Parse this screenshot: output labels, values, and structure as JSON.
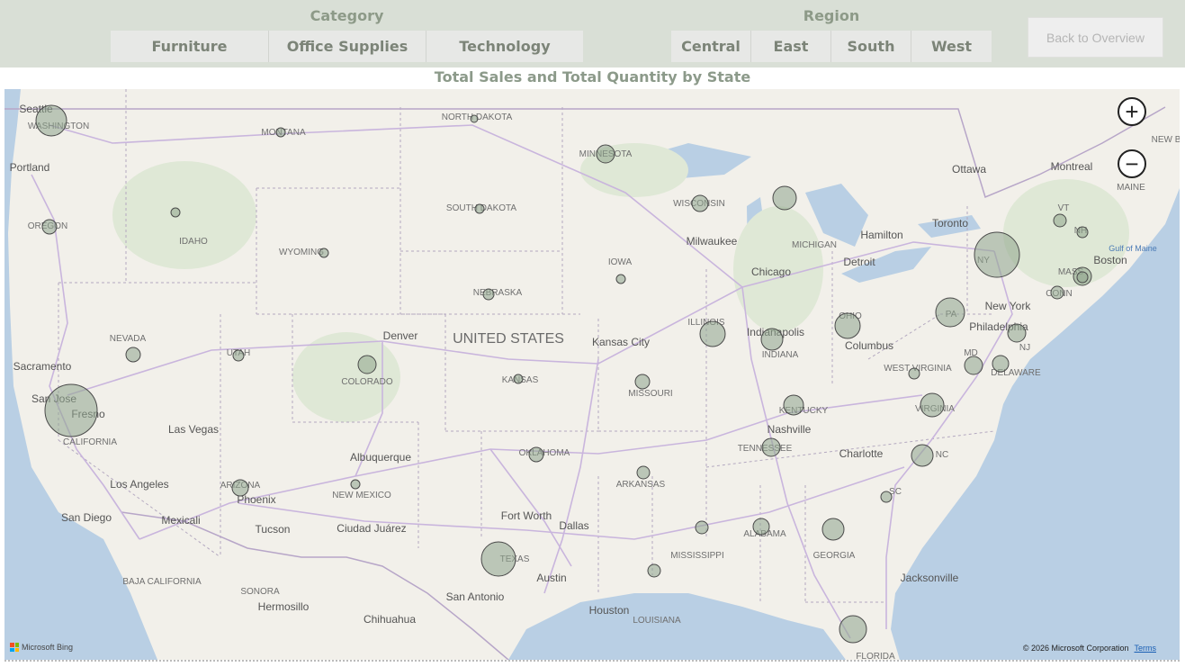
{
  "category_slicer": {
    "title": "Category",
    "options": [
      "Furniture",
      "Office Supplies",
      "Technology"
    ]
  },
  "region_slicer": {
    "title": "Region",
    "options": [
      "Central",
      "East",
      "South",
      "West"
    ]
  },
  "back_button": {
    "label": "Back to Overview"
  },
  "chart": {
    "title": "Total Sales and Total Quantity by State"
  },
  "map": {
    "zoom_in": "+",
    "zoom_out": "−",
    "country_label": "UNITED STATES",
    "state_labels": [
      "WASHINGTON",
      "OREGON",
      "IDAHO",
      "MONTANA",
      "NORTH DAKOTA",
      "SOUTH DAKOTA",
      "WYOMING",
      "NEBRASKA",
      "NEVADA",
      "UTAH",
      "COLORADO",
      "KANSAS",
      "CALIFORNIA",
      "ARIZONA",
      "NEW MEXICO",
      "OKLAHOMA",
      "TEXAS",
      "MINNESOTA",
      "IOWA",
      "MISSOURI",
      "ARKANSAS",
      "WISCONSIN",
      "ILLINOIS",
      "MICHIGAN",
      "INDIANA",
      "OHIO",
      "KENTUCKY",
      "TENNESSEE",
      "MISSISSIPPI",
      "ALABAMA",
      "GEORGIA",
      "FLORIDA",
      "WEST VIRGINIA",
      "VIRGINIA",
      "NC",
      "SC",
      "PA",
      "NY",
      "MD",
      "DELAWARE",
      "NJ",
      "CONN",
      "MASS",
      "VT",
      "NH",
      "MAINE",
      "NEW B",
      "BAJA CALIFORNIA",
      "SONORA",
      "LOUISIANA"
    ],
    "city_labels": [
      "Seattle",
      "Portland",
      "Sacramento",
      "San Jose",
      "Fresno",
      "Las Vegas",
      "Los Angeles",
      "San Diego",
      "Mexicali",
      "Phoenix",
      "Tucson",
      "Albuquerque",
      "Ciudad Juárez",
      "Denver",
      "Kansas City",
      "Dallas",
      "Fort Worth",
      "Austin",
      "San Antonio",
      "Houston",
      "Hermosillo",
      "Chihuahua",
      "Milwaukee",
      "Chicago",
      "Indianapolis",
      "Columbus",
      "Nashville",
      "Charlotte",
      "Jacksonville",
      "Detroit",
      "Toronto",
      "Hamilton",
      "Ottawa",
      "Montreal",
      "New York",
      "Philadelphia",
      "Boston",
      "Gulf of Maine"
    ],
    "bubble_color": "#8ea48c",
    "bing_label": "Microsoft Bing",
    "copyright": "© 2026 Microsoft Corporation",
    "terms": "Terms"
  },
  "chart_data": {
    "type": "scatter",
    "title": "Total Sales and Total Quantity by State",
    "series": [
      {
        "points": [
          "Washington",
          "Oregon",
          "Idaho",
          "Montana",
          "North Dakota",
          "South Dakota",
          "Wyoming",
          "Nebraska",
          "Nevada",
          "Utah",
          "Colorado",
          "Kansas",
          "California",
          "Arizona",
          "New Mexico",
          "Oklahoma",
          "Texas",
          "Minnesota",
          "Iowa",
          "Missouri",
          "Arkansas",
          "Wisconsin",
          "Illinois",
          "Michigan",
          "Indiana",
          "Ohio",
          "Kentucky",
          "Tennessee",
          "Mississippi",
          "Alabama",
          "Georgia",
          "Florida",
          "West Virginia",
          "Virginia",
          "North Carolina",
          "South Carolina",
          "Pennsylvania",
          "New York",
          "Maryland",
          "Delaware",
          "New Jersey",
          "Connecticut",
          "Massachusetts",
          "Vermont",
          "New Hampshire",
          "Maine",
          "Louisiana"
        ]
      }
    ]
  }
}
